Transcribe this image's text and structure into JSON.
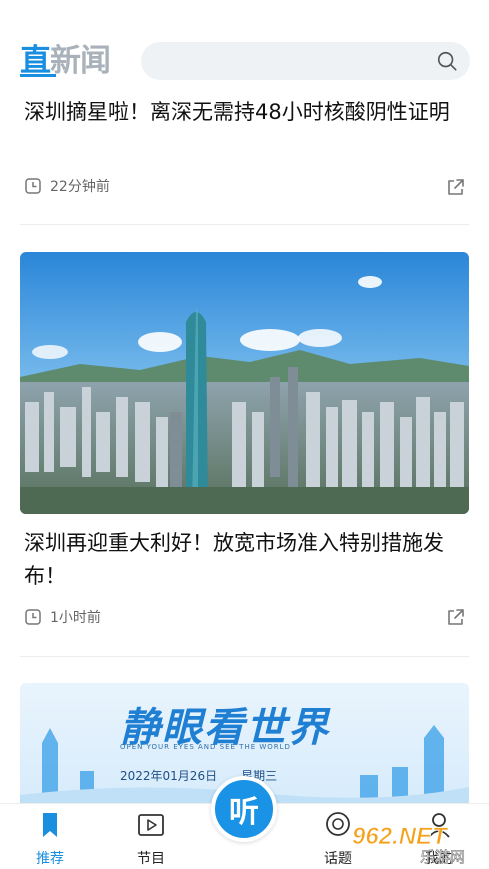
{
  "header": {
    "logo_first": "直",
    "logo_rest": "新闻",
    "search_icon": "search-icon"
  },
  "articles": [
    {
      "headline": "深圳摘星啦！离深无需持48小时核酸阴性证明",
      "time": "22分钟前",
      "icons": [
        "clock-icon",
        "share-icon"
      ]
    },
    {
      "headline": "深圳再迎重大利好！放宽市场准入特别措施发布！",
      "time": "1小时前",
      "icons": [
        "clock-icon",
        "share-icon"
      ]
    }
  ],
  "banner": {
    "title": "静眼看世界",
    "subtitle": "OPEN YOUR EYES AND SEE THE WORLD",
    "date": "2022年01月26日",
    "weekday": "星期三"
  },
  "bottom_nav": {
    "items": [
      {
        "label": "推荐",
        "icon": "bookmark-icon",
        "active": true
      },
      {
        "label": "节目",
        "icon": "play-icon",
        "active": false
      },
      {
        "label": "话题",
        "icon": "chat-icon",
        "active": false
      },
      {
        "label": "我的",
        "icon": "user-icon",
        "active": false
      }
    ],
    "center_label": "听"
  },
  "watermark": {
    "brand": "962.NET",
    "caption": "乐游网"
  },
  "colors": {
    "accent": "#1a8fe0",
    "text": "#111111",
    "meta": "#666666"
  }
}
